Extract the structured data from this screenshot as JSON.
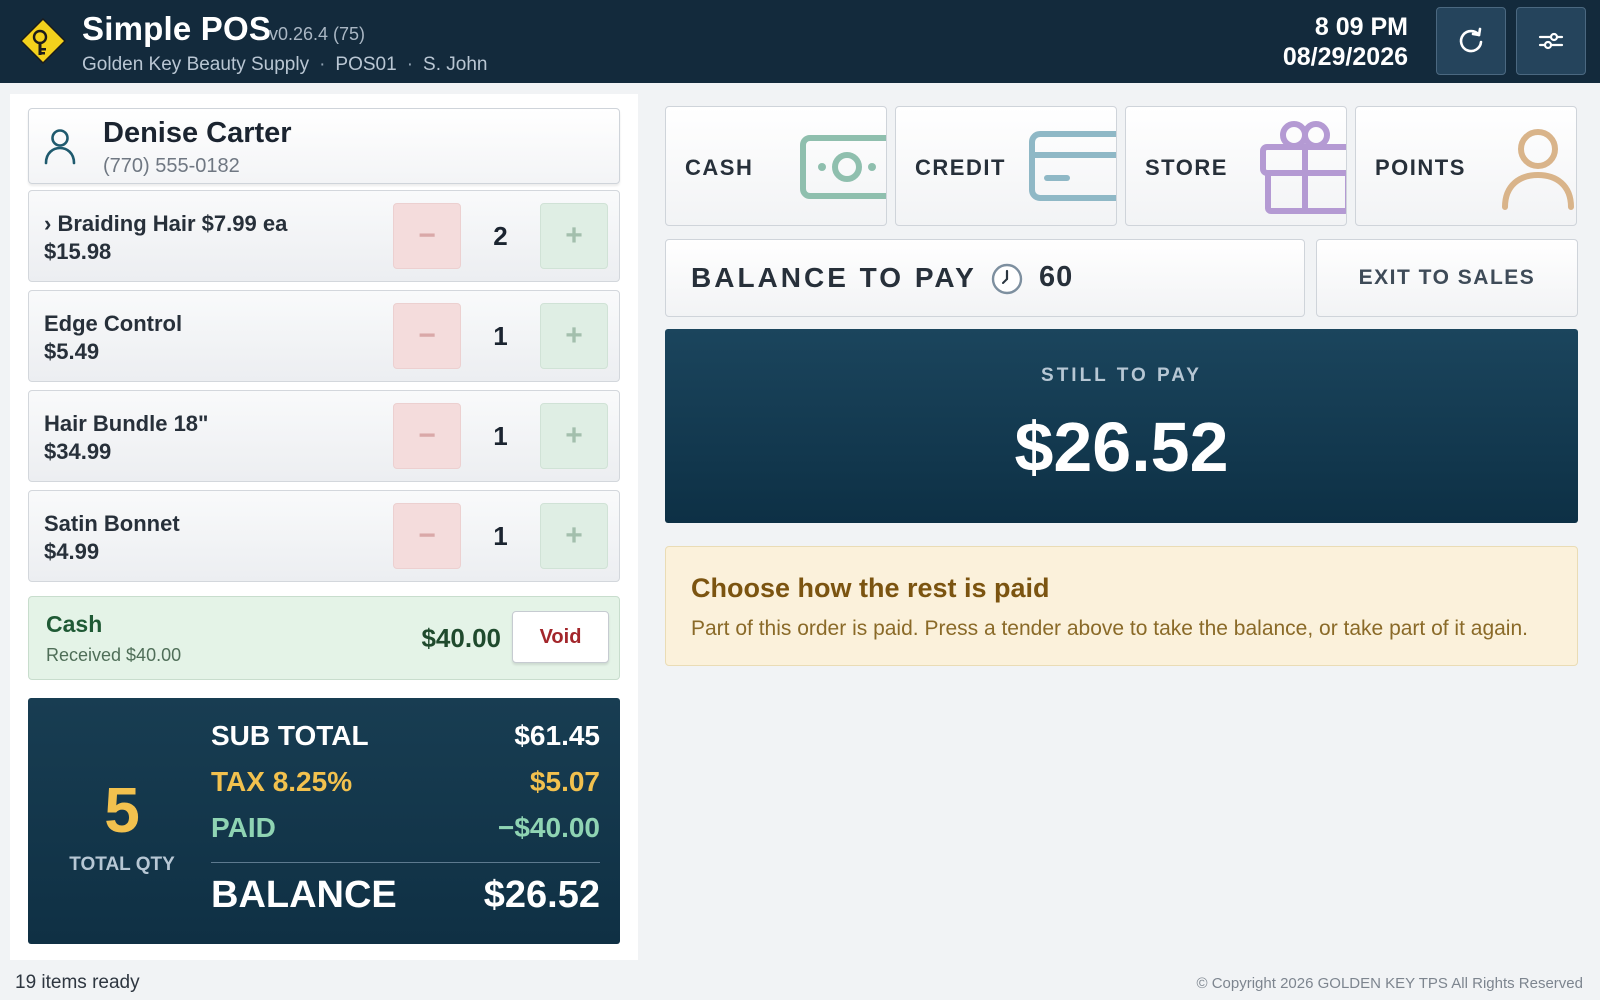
{
  "header": {
    "app_title": "Simple POS",
    "version": "v0.26.4 (75)",
    "store_name": "Golden Key Beauty Supply",
    "register": "POS01",
    "cashier": "S. John",
    "separator": "·",
    "time": "8 09 PM",
    "date": "08/29/2026",
    "logo_icon": "golden-key-logo-icon",
    "refresh_icon": "refresh-icon",
    "settings_icon": "sliders-icon"
  },
  "customer": {
    "name": "Denise Carter",
    "phone": "(770) 555-0182",
    "icon": "user-icon"
  },
  "line_items": [
    {
      "name": "› Braiding Hair  $7.99 ea",
      "price": "$15.98",
      "qty": "2"
    },
    {
      "name": "Edge Control",
      "price": "$5.49",
      "qty": "1"
    },
    {
      "name": "Hair Bundle 18\"",
      "price": "$34.99",
      "qty": "1"
    },
    {
      "name": "Satin Bonnet",
      "price": "$4.99",
      "qty": "1"
    }
  ],
  "qty_controls": {
    "minus": "−",
    "plus": "+"
  },
  "payment": {
    "method": "Cash",
    "received": "Received $40.00",
    "amount": "$40.00",
    "void_label": "Void"
  },
  "totals": {
    "total_qty": "5",
    "total_qty_label": "TOTAL QTY",
    "sub_total_label": "SUB TOTAL",
    "sub_total": "$61.45",
    "tax_label": "TAX 8.25%",
    "tax": "$5.07",
    "paid_label": "PAID",
    "paid": "−$40.00",
    "balance_label": "BALANCE",
    "balance": "$26.52"
  },
  "tenders": [
    {
      "label": "CASH",
      "icon": "cash-icon",
      "color": "#8fbfae"
    },
    {
      "label": "CREDIT",
      "icon": "credit-card-icon",
      "color": "#8fb8c6"
    },
    {
      "label": "STORE",
      "icon": "gift-icon",
      "color": "#b49ad3"
    },
    {
      "label": "POINTS",
      "icon": "person-icon",
      "color": "#d9b48a"
    }
  ],
  "balance_to_pay": {
    "label": "BALANCE TO PAY",
    "countdown": "60",
    "icon": "clock-icon"
  },
  "exit_label": "EXIT TO SALES",
  "still_to_pay": {
    "label": "STILL TO PAY",
    "amount": "$26.52"
  },
  "notice": {
    "title": "Choose how the rest is paid",
    "body": "Part of this order is paid. Press a tender above to take the balance, or take part of it again."
  },
  "status": {
    "left": "19 items ready",
    "right": "© Copyright 2026 GOLDEN KEY TPS All Rights Reserved"
  },
  "colors": {
    "header_bg": "#132a3c",
    "accent_gold": "#f2c14e",
    "panel_dark": "#0f3044",
    "paid_green": "#8fd4b3",
    "void_red": "#a3262b"
  }
}
